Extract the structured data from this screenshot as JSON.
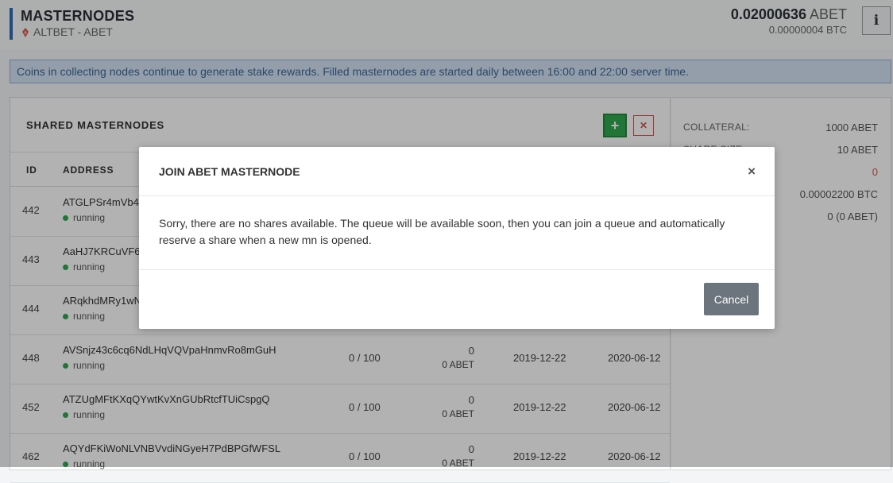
{
  "header": {
    "title": "MASTERNODES",
    "coin_label": "ALTBET - ABET",
    "price_abet_value": "0.02000636",
    "price_abet_unit": "ABET",
    "price_btc": "0.00000004 BTC",
    "info_label": "i",
    "accent_color": "#2d6bbf"
  },
  "notice": {
    "text": "Coins in collecting nodes continue to generate stake rewards. Filled masternodes are started daily between 16:00 and 22:00 server time."
  },
  "panel": {
    "title": "SHARED MASTERNODES",
    "add_label": "+",
    "remove_label": "✕",
    "columns": {
      "id": "ID",
      "address": "ADDRESS"
    },
    "rows": [
      {
        "id": "442",
        "address": "ATGLPSr4mVb45",
        "status": "running",
        "shares": "",
        "count": "",
        "amount": "",
        "date1": "",
        "date2": ""
      },
      {
        "id": "443",
        "address": "AaHJ7KRCuVF6z",
        "status": "running",
        "shares": "",
        "count": "",
        "amount": "",
        "date1": "",
        "date2": ""
      },
      {
        "id": "444",
        "address": "ARqkhdMRy1wN",
        "status": "running",
        "shares": "",
        "count": "",
        "amount": "",
        "date1": "",
        "date2": ""
      },
      {
        "id": "448",
        "address": "AVSnjz43c6cq6NdLHqVQVpaHnmvRo8mGuH",
        "status": "running",
        "shares": "0 / 100",
        "count": "0",
        "amount": "0 ABET",
        "date1": "2019-12-22",
        "date2": "2020-06-12"
      },
      {
        "id": "452",
        "address": "ATZUgMFtKXqQYwtKvXnGUbRtcfTUiCspgQ",
        "status": "running",
        "shares": "0 / 100",
        "count": "0",
        "amount": "0 ABET",
        "date1": "2019-12-22",
        "date2": "2020-06-12"
      },
      {
        "id": "462",
        "address": "AQYdFKiWoNLVNBVvdiNGyeH7PdBPGfWFSL",
        "status": "running",
        "shares": "0 / 100",
        "count": "0",
        "amount": "0 ABET",
        "date1": "2019-12-22",
        "date2": "2020-06-12"
      }
    ]
  },
  "side": {
    "items": [
      {
        "key": "COLLATERAL:",
        "value": "1000 ABET"
      },
      {
        "key": "SHARE SIZE:",
        "value": "10 ABET"
      },
      {
        "key": "",
        "value": "0"
      },
      {
        "key": "",
        "value": "0.00002200 BTC"
      },
      {
        "key": "",
        "value": "0 (0 ABET)"
      }
    ]
  },
  "modal": {
    "title": "JOIN ABET MASTERNODE",
    "close_label": "×",
    "message": "Sorry, there are no shares available. The queue will be available soon, then you can join a queue and automatically reserve a share when a new mn is opened.",
    "cancel_label": "Cancel"
  },
  "colors": {
    "add_button": "#2fa84f",
    "remove_button": "#d9534f",
    "running_dot": "#2fa84f",
    "cancel_button": "#6c757d",
    "notice_bg": "#d4e3f4"
  }
}
